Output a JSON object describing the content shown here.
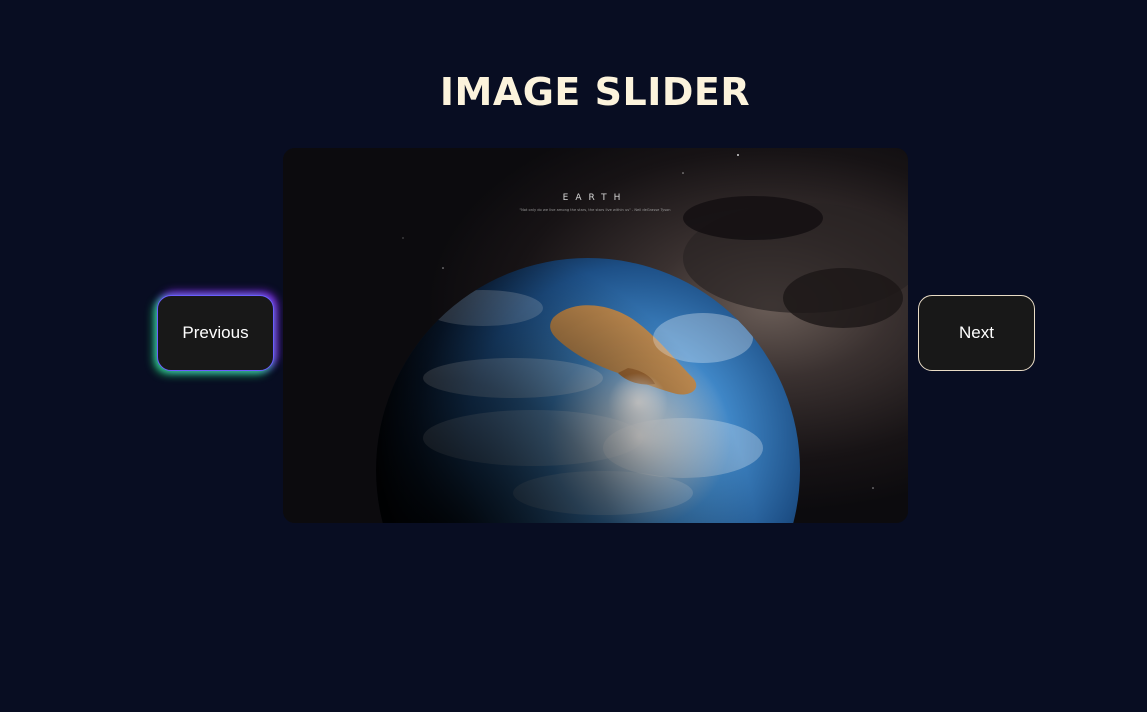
{
  "page": {
    "title": "IMAGE SLIDER"
  },
  "slider": {
    "previous_label": "Previous",
    "next_label": "Next",
    "slide": {
      "heading": "EARTH",
      "quote": "\"Not only do we live among the stars, the stars live within us\" - Neil deGrasse Tyson"
    }
  },
  "colors": {
    "background": "#080d22",
    "title": "#fcf3dc",
    "button_bg": "#181818",
    "button_text": "#ffffff",
    "next_border": "#e9dcc6",
    "glow_green": "#28e678",
    "glow_purple": "#9628ff",
    "glow_blue": "#466eff"
  }
}
